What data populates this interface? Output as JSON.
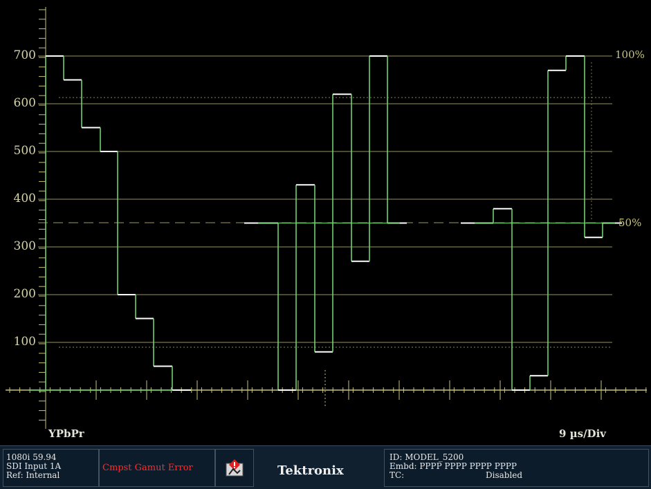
{
  "waveform": {
    "y_axis_labels": [
      "700",
      "600",
      "500",
      "400",
      "300",
      "200",
      "100"
    ],
    "percent_labels": {
      "top": "100%",
      "mid": "50%"
    },
    "color_space": "YPbPr",
    "time_scale": "9 µs/Div",
    "trace_color": "#6fd36f",
    "level_color": "#ffffff",
    "graticule_color": "#c8c37c"
  },
  "chart_data": {
    "type": "line",
    "ylim": [
      0,
      700
    ],
    "y_ticks": [
      100,
      200,
      300,
      400,
      500,
      600,
      700
    ],
    "segments": [
      {
        "name": "Y",
        "levels": [
          700,
          650,
          550,
          500,
          200,
          150,
          50,
          0
        ]
      },
      {
        "name": "Pb",
        "levels": [
          350,
          0,
          430,
          80,
          620,
          270,
          700,
          350
        ]
      },
      {
        "name": "Pr",
        "levels": [
          350,
          380,
          0,
          30,
          670,
          700,
          320,
          350
        ]
      }
    ]
  },
  "status": {
    "format": "1080i 59.94",
    "input": "SDI Input 1A",
    "ref": "Ref: Internal",
    "error": "Cmpst Gamut Error",
    "alarm_icon": "alarm-bell-icon",
    "brand": "Tektronix",
    "id": "ID: MODEL_5200",
    "embd": "Embd: PPPP PPPP PPPP PPPP",
    "tc_label": "TC:",
    "tc_value": "Disabled"
  }
}
